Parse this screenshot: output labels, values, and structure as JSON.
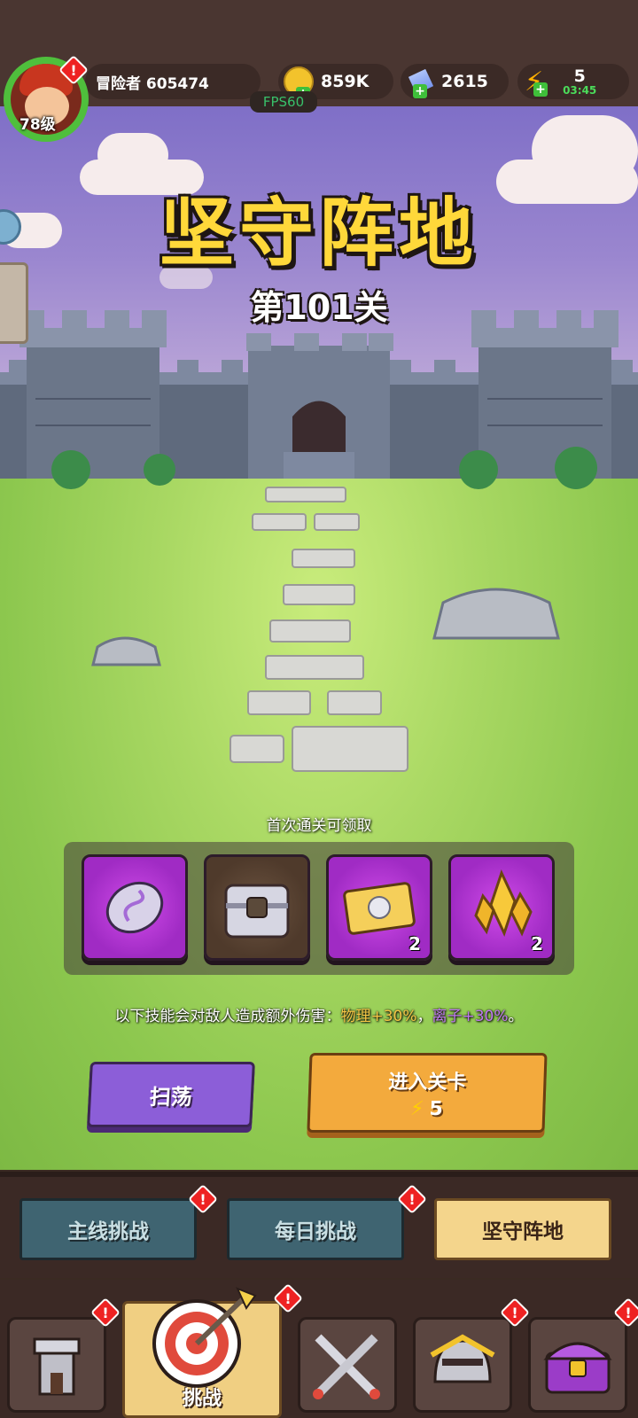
{
  "player": {
    "name_label": "冒险者 605474",
    "level": "78级"
  },
  "resources": {
    "gold": "859K",
    "gems": "2615",
    "energy": "5",
    "energy_timer": "03:45"
  },
  "fps": "FPS60",
  "stage": {
    "title": "坚守阵地",
    "subtitle": "第101关"
  },
  "rewards": {
    "label": "首次通关可领取",
    "items": [
      {
        "icon": "rune-stone-icon",
        "count": ""
      },
      {
        "icon": "treasure-chest-icon",
        "count": ""
      },
      {
        "icon": "gold-ticket-icon",
        "count": "2"
      },
      {
        "icon": "gold-crystal-icon",
        "count": "2"
      }
    ]
  },
  "skill_note": {
    "prefix": "以下技能会对敌人造成额外伤害：",
    "phys": "物理+30%",
    "sep": "，",
    "ion": "离子+30%",
    "end": "。"
  },
  "buttons": {
    "sweep": "扫荡",
    "enter": "进入关卡",
    "enter_cost": "5"
  },
  "tabs": [
    {
      "label": "主线挑战",
      "alert": "!"
    },
    {
      "label": "每日挑战",
      "alert": "!"
    },
    {
      "label": "坚守阵地",
      "alert": ""
    }
  ],
  "nav": {
    "challenge_label": "挑战",
    "alert": "!"
  },
  "colors": {
    "title": "#ffd83a",
    "phys": "#f6c746",
    "ion": "#c07af0",
    "alert": "#e22222"
  }
}
